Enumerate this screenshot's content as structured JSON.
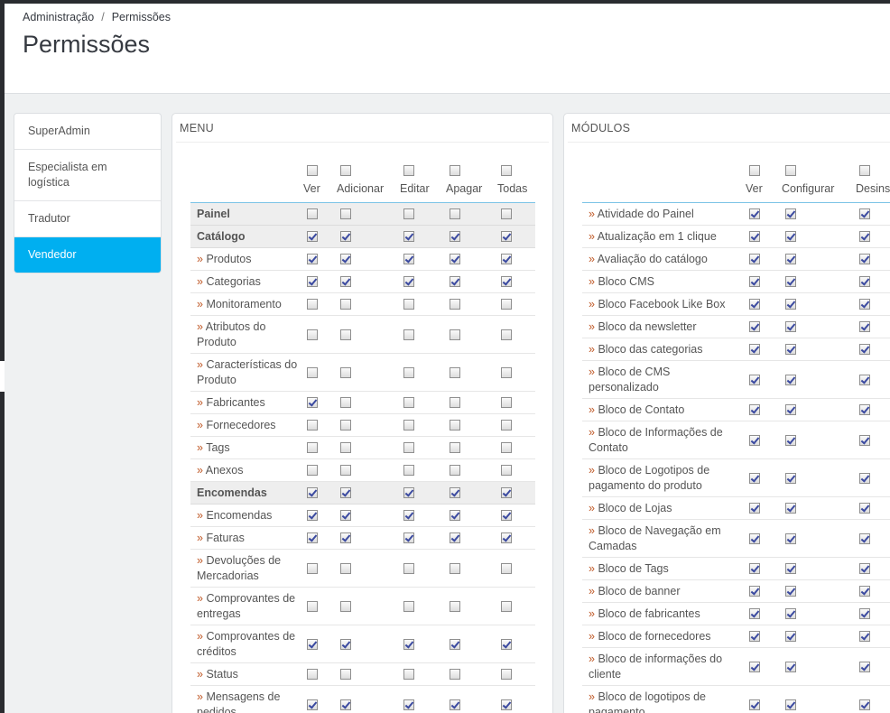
{
  "breadcrumb": {
    "parent": "Administração",
    "separator": "/",
    "current": "Permissões"
  },
  "page_title": "Permissões",
  "colors": {
    "accent": "#00aff0",
    "header_border": "#7cc4e6"
  },
  "profiles": [
    {
      "label": "SuperAdmin",
      "active": false
    },
    {
      "label": "Especialista em logística",
      "active": false
    },
    {
      "label": "Tradutor",
      "active": false
    },
    {
      "label": "Vendedor",
      "active": true
    }
  ],
  "menu": {
    "title": "MENU",
    "columns": [
      "Ver",
      "Adicionar",
      "Editar",
      "Apagar",
      "Todas"
    ],
    "rows": [
      {
        "label": "Painel",
        "group": true,
        "checked": [
          false,
          false,
          false,
          false,
          false
        ]
      },
      {
        "label": "Catálogo",
        "group": true,
        "checked": [
          true,
          true,
          true,
          true,
          true
        ]
      },
      {
        "label": "Produtos",
        "group": false,
        "checked": [
          true,
          true,
          true,
          true,
          true
        ]
      },
      {
        "label": "Categorias",
        "group": false,
        "checked": [
          true,
          true,
          true,
          true,
          true
        ]
      },
      {
        "label": "Monitoramento",
        "group": false,
        "checked": [
          false,
          false,
          false,
          false,
          false
        ]
      },
      {
        "label": "Atributos do Produto",
        "group": false,
        "checked": [
          false,
          false,
          false,
          false,
          false
        ]
      },
      {
        "label": "Características do Produto",
        "group": false,
        "checked": [
          false,
          false,
          false,
          false,
          false
        ]
      },
      {
        "label": "Fabricantes",
        "group": false,
        "checked": [
          true,
          false,
          false,
          false,
          false
        ]
      },
      {
        "label": "Fornecedores",
        "group": false,
        "checked": [
          false,
          false,
          false,
          false,
          false
        ]
      },
      {
        "label": "Tags",
        "group": false,
        "checked": [
          false,
          false,
          false,
          false,
          false
        ]
      },
      {
        "label": "Anexos",
        "group": false,
        "checked": [
          false,
          false,
          false,
          false,
          false
        ]
      },
      {
        "label": "Encomendas",
        "group": true,
        "checked": [
          true,
          true,
          true,
          true,
          true
        ]
      },
      {
        "label": "Encomendas",
        "group": false,
        "checked": [
          true,
          true,
          true,
          true,
          true
        ]
      },
      {
        "label": "Faturas",
        "group": false,
        "checked": [
          true,
          true,
          true,
          true,
          true
        ]
      },
      {
        "label": "Devoluções de Mercadorias",
        "group": false,
        "checked": [
          false,
          false,
          false,
          false,
          false
        ]
      },
      {
        "label": "Comprovantes de entregas",
        "group": false,
        "checked": [
          false,
          false,
          false,
          false,
          false
        ]
      },
      {
        "label": "Comprovantes de créditos",
        "group": false,
        "checked": [
          true,
          true,
          true,
          true,
          true
        ]
      },
      {
        "label": "Status",
        "group": false,
        "checked": [
          false,
          false,
          false,
          false,
          false
        ]
      },
      {
        "label": "Mensagens de pedidos",
        "group": false,
        "checked": [
          true,
          true,
          true,
          true,
          true
        ]
      },
      {
        "label": "",
        "group": true,
        "checked": [
          false,
          false,
          false,
          false,
          false
        ]
      }
    ]
  },
  "modules": {
    "title": "MÓDULOS",
    "columns": [
      "Ver",
      "Configurar",
      "Desins"
    ],
    "rows": [
      {
        "label": "Atividade do Painel",
        "checked": [
          true,
          true,
          true
        ]
      },
      {
        "label": "Atualização em 1 clique",
        "checked": [
          true,
          true,
          true
        ]
      },
      {
        "label": "Avaliação do catálogo",
        "checked": [
          true,
          true,
          true
        ]
      },
      {
        "label": "Bloco CMS",
        "checked": [
          true,
          true,
          true
        ]
      },
      {
        "label": "Bloco Facebook Like Box",
        "checked": [
          true,
          true,
          true
        ]
      },
      {
        "label": "Bloco da newsletter",
        "checked": [
          true,
          true,
          true
        ]
      },
      {
        "label": "Bloco das categorias",
        "checked": [
          true,
          true,
          true
        ]
      },
      {
        "label": "Bloco de CMS personalizado",
        "checked": [
          true,
          true,
          true
        ]
      },
      {
        "label": "Bloco de Contato",
        "checked": [
          true,
          true,
          true
        ]
      },
      {
        "label": "Bloco de Informações de Contato",
        "checked": [
          true,
          true,
          true
        ]
      },
      {
        "label": "Bloco de Logotipos de pagamento do produto",
        "checked": [
          true,
          true,
          true
        ]
      },
      {
        "label": "Bloco de Lojas",
        "checked": [
          true,
          true,
          true
        ]
      },
      {
        "label": "Bloco de Navegação em Camadas",
        "checked": [
          true,
          true,
          true
        ]
      },
      {
        "label": "Bloco de Tags",
        "checked": [
          true,
          true,
          true
        ]
      },
      {
        "label": "Bloco de banner",
        "checked": [
          true,
          true,
          true
        ]
      },
      {
        "label": "Bloco de fabricantes",
        "checked": [
          true,
          true,
          true
        ]
      },
      {
        "label": "Bloco de fornecedores",
        "checked": [
          true,
          true,
          true
        ]
      },
      {
        "label": "Bloco de informações do cliente",
        "checked": [
          true,
          true,
          true
        ]
      },
      {
        "label": "Bloco de logotipos de pagamento",
        "checked": [
          true,
          true,
          true
        ]
      }
    ]
  }
}
